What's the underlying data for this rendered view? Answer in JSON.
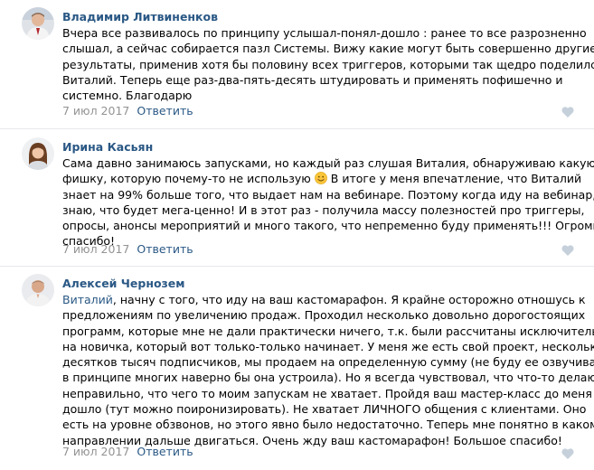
{
  "comments": [
    {
      "author": "Владимир Литвиненков",
      "lines": [
        "Вчера все развивалось по принципу услышал-понял-дошло : ранее то все разрозненно",
        "слышал, а сейчас собирается пазл Системы. Вижу какие могут быть совершенно другие",
        "результаты, применив хотя бы половину всех триггеров, которыми так щедро поделился",
        "Виталий. Теперь еще раз-два-пять-десять штудировать и применять пофишечно и",
        "системно. Благодарю"
      ],
      "date": "7 июл 2017",
      "reply_label": "Ответить"
    },
    {
      "author": "Ирина Касьян",
      "lines": [
        "Сама давно занимаюсь запусками, но каждый раз слушая Виталия, обнаруживаю какую-то",
        "фишку, которую почему-то не использую",
        "знает на 99% больше того, что выдает нам на вебинаре. Поэтому когда иду на вебинар,",
        "знаю, что будет мега-ценно! И в этот раз - получила массу полезностей про триггеры,",
        "опросы, анонсы мероприятий и много такого, что непременно буду применять!!! Огромное",
        "спасибо!"
      ],
      "line2_after_emoji": " В итоге у меня впечатление, что Виталий",
      "date": "7 июл 2017",
      "reply_label": "Ответить"
    },
    {
      "author": "Алексей Чернозем",
      "mention": "Виталий",
      "first_line_rest": ", начну с того, что иду на ваш кастомарафон. Я крайне осторожно отношусь к",
      "lines": [
        "предложениям по увеличению продаж. Проходил несколько довольно дорогостоящих",
        "программ, которые мне не дали практически ничего, т.к. были рассчитаны исключительно",
        "на новичка, который вот только-только начинает. У меня же есть свой проект, несколько",
        "десятков тысяч подписчиков, мы продаем на определенную сумму (не буду ее озвучивать,",
        "в принципе многих наверно бы она устроила). Но я всегда чувствовал, что что-то делаю",
        "неправильно, что чего то моим запускам не хватает. Пройдя ваш мастер-класс до меня",
        "дошло (тут можно поиронизировать). Не хватает ЛИЧНОГО общения с клиентами. Оно",
        "есть на уровне обзвонов, но этого явно было недостаточно. Теперь мне понятно в каком",
        "направлении дальше двигаться. Очень жду ваш кастомарафон! Большое спасибо!"
      ],
      "date": "7 июл 2017",
      "reply_label": "Ответить"
    }
  ],
  "colors": {
    "link": "#2a5885",
    "meta": "#939393",
    "text": "#000000",
    "divider": "#e7e8ec",
    "like_icon": "#c5d0db"
  },
  "icons": [
    "heart-icon",
    "smile-emoji-icon"
  ]
}
